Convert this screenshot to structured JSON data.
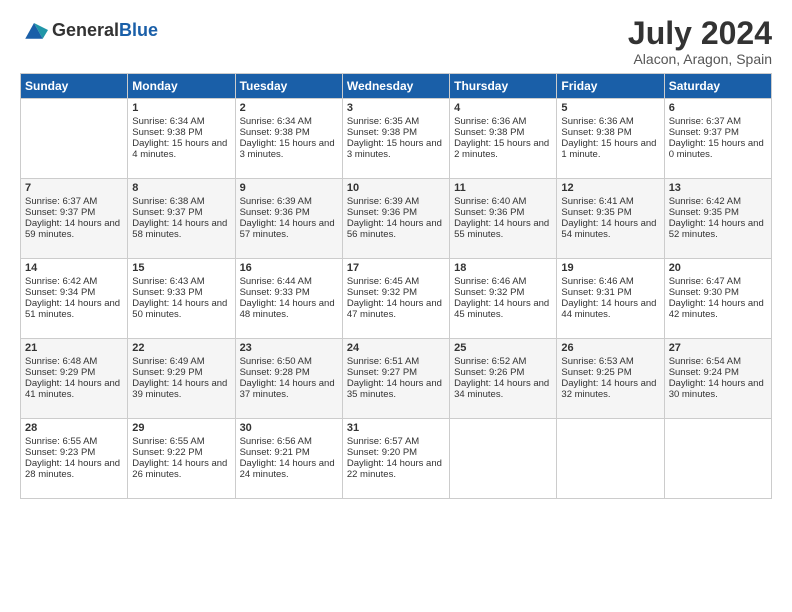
{
  "header": {
    "logo_general": "General",
    "logo_blue": "Blue",
    "title": "July 2024",
    "subtitle": "Alacon, Aragon, Spain"
  },
  "days_of_week": [
    "Sunday",
    "Monday",
    "Tuesday",
    "Wednesday",
    "Thursday",
    "Friday",
    "Saturday"
  ],
  "weeks": [
    [
      {
        "day": "",
        "sunrise": "",
        "sunset": "",
        "daylight": ""
      },
      {
        "day": "1",
        "sunrise": "Sunrise: 6:34 AM",
        "sunset": "Sunset: 9:38 PM",
        "daylight": "Daylight: 15 hours and 4 minutes."
      },
      {
        "day": "2",
        "sunrise": "Sunrise: 6:34 AM",
        "sunset": "Sunset: 9:38 PM",
        "daylight": "Daylight: 15 hours and 3 minutes."
      },
      {
        "day": "3",
        "sunrise": "Sunrise: 6:35 AM",
        "sunset": "Sunset: 9:38 PM",
        "daylight": "Daylight: 15 hours and 3 minutes."
      },
      {
        "day": "4",
        "sunrise": "Sunrise: 6:36 AM",
        "sunset": "Sunset: 9:38 PM",
        "daylight": "Daylight: 15 hours and 2 minutes."
      },
      {
        "day": "5",
        "sunrise": "Sunrise: 6:36 AM",
        "sunset": "Sunset: 9:38 PM",
        "daylight": "Daylight: 15 hours and 1 minute."
      },
      {
        "day": "6",
        "sunrise": "Sunrise: 6:37 AM",
        "sunset": "Sunset: 9:37 PM",
        "daylight": "Daylight: 15 hours and 0 minutes."
      }
    ],
    [
      {
        "day": "7",
        "sunrise": "Sunrise: 6:37 AM",
        "sunset": "Sunset: 9:37 PM",
        "daylight": "Daylight: 14 hours and 59 minutes."
      },
      {
        "day": "8",
        "sunrise": "Sunrise: 6:38 AM",
        "sunset": "Sunset: 9:37 PM",
        "daylight": "Daylight: 14 hours and 58 minutes."
      },
      {
        "day": "9",
        "sunrise": "Sunrise: 6:39 AM",
        "sunset": "Sunset: 9:36 PM",
        "daylight": "Daylight: 14 hours and 57 minutes."
      },
      {
        "day": "10",
        "sunrise": "Sunrise: 6:39 AM",
        "sunset": "Sunset: 9:36 PM",
        "daylight": "Daylight: 14 hours and 56 minutes."
      },
      {
        "day": "11",
        "sunrise": "Sunrise: 6:40 AM",
        "sunset": "Sunset: 9:36 PM",
        "daylight": "Daylight: 14 hours and 55 minutes."
      },
      {
        "day": "12",
        "sunrise": "Sunrise: 6:41 AM",
        "sunset": "Sunset: 9:35 PM",
        "daylight": "Daylight: 14 hours and 54 minutes."
      },
      {
        "day": "13",
        "sunrise": "Sunrise: 6:42 AM",
        "sunset": "Sunset: 9:35 PM",
        "daylight": "Daylight: 14 hours and 52 minutes."
      }
    ],
    [
      {
        "day": "14",
        "sunrise": "Sunrise: 6:42 AM",
        "sunset": "Sunset: 9:34 PM",
        "daylight": "Daylight: 14 hours and 51 minutes."
      },
      {
        "day": "15",
        "sunrise": "Sunrise: 6:43 AM",
        "sunset": "Sunset: 9:33 PM",
        "daylight": "Daylight: 14 hours and 50 minutes."
      },
      {
        "day": "16",
        "sunrise": "Sunrise: 6:44 AM",
        "sunset": "Sunset: 9:33 PM",
        "daylight": "Daylight: 14 hours and 48 minutes."
      },
      {
        "day": "17",
        "sunrise": "Sunrise: 6:45 AM",
        "sunset": "Sunset: 9:32 PM",
        "daylight": "Daylight: 14 hours and 47 minutes."
      },
      {
        "day": "18",
        "sunrise": "Sunrise: 6:46 AM",
        "sunset": "Sunset: 9:32 PM",
        "daylight": "Daylight: 14 hours and 45 minutes."
      },
      {
        "day": "19",
        "sunrise": "Sunrise: 6:46 AM",
        "sunset": "Sunset: 9:31 PM",
        "daylight": "Daylight: 14 hours and 44 minutes."
      },
      {
        "day": "20",
        "sunrise": "Sunrise: 6:47 AM",
        "sunset": "Sunset: 9:30 PM",
        "daylight": "Daylight: 14 hours and 42 minutes."
      }
    ],
    [
      {
        "day": "21",
        "sunrise": "Sunrise: 6:48 AM",
        "sunset": "Sunset: 9:29 PM",
        "daylight": "Daylight: 14 hours and 41 minutes."
      },
      {
        "day": "22",
        "sunrise": "Sunrise: 6:49 AM",
        "sunset": "Sunset: 9:29 PM",
        "daylight": "Daylight: 14 hours and 39 minutes."
      },
      {
        "day": "23",
        "sunrise": "Sunrise: 6:50 AM",
        "sunset": "Sunset: 9:28 PM",
        "daylight": "Daylight: 14 hours and 37 minutes."
      },
      {
        "day": "24",
        "sunrise": "Sunrise: 6:51 AM",
        "sunset": "Sunset: 9:27 PM",
        "daylight": "Daylight: 14 hours and 35 minutes."
      },
      {
        "day": "25",
        "sunrise": "Sunrise: 6:52 AM",
        "sunset": "Sunset: 9:26 PM",
        "daylight": "Daylight: 14 hours and 34 minutes."
      },
      {
        "day": "26",
        "sunrise": "Sunrise: 6:53 AM",
        "sunset": "Sunset: 9:25 PM",
        "daylight": "Daylight: 14 hours and 32 minutes."
      },
      {
        "day": "27",
        "sunrise": "Sunrise: 6:54 AM",
        "sunset": "Sunset: 9:24 PM",
        "daylight": "Daylight: 14 hours and 30 minutes."
      }
    ],
    [
      {
        "day": "28",
        "sunrise": "Sunrise: 6:55 AM",
        "sunset": "Sunset: 9:23 PM",
        "daylight": "Daylight: 14 hours and 28 minutes."
      },
      {
        "day": "29",
        "sunrise": "Sunrise: 6:55 AM",
        "sunset": "Sunset: 9:22 PM",
        "daylight": "Daylight: 14 hours and 26 minutes."
      },
      {
        "day": "30",
        "sunrise": "Sunrise: 6:56 AM",
        "sunset": "Sunset: 9:21 PM",
        "daylight": "Daylight: 14 hours and 24 minutes."
      },
      {
        "day": "31",
        "sunrise": "Sunrise: 6:57 AM",
        "sunset": "Sunset: 9:20 PM",
        "daylight": "Daylight: 14 hours and 22 minutes."
      },
      {
        "day": "",
        "sunrise": "",
        "sunset": "",
        "daylight": ""
      },
      {
        "day": "",
        "sunrise": "",
        "sunset": "",
        "daylight": ""
      },
      {
        "day": "",
        "sunrise": "",
        "sunset": "",
        "daylight": ""
      }
    ]
  ]
}
